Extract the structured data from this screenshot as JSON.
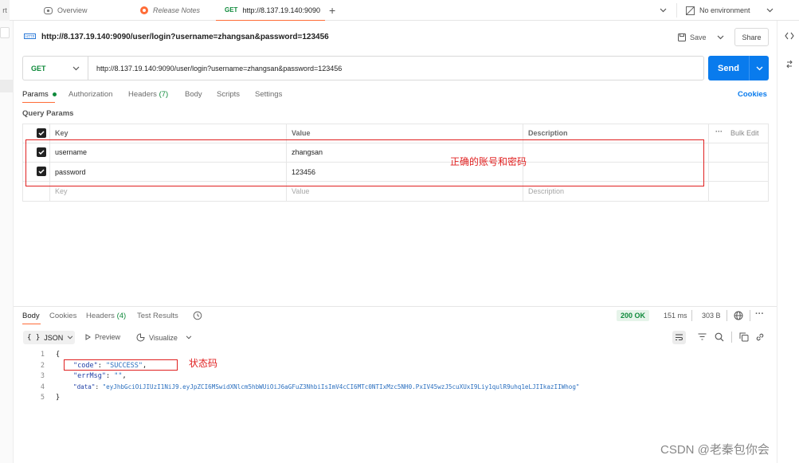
{
  "tabs": {
    "partial_left": "rt",
    "overview": "Overview",
    "release_notes": "Release Notes",
    "active_method": "GET",
    "active_url": "http://8.137.19.140:9090",
    "new_tab": "+",
    "environment": "No environment"
  },
  "request": {
    "title_url": "http://8.137.19.140:9090/user/login?username=zhangsan&password=123456",
    "save_label": "Save",
    "share_label": "Share",
    "method": "GET",
    "url": "http://8.137.19.140:9090/user/login?username=zhangsan&password=123456",
    "send_label": "Send"
  },
  "request_tabs": [
    {
      "label": "Params"
    },
    {
      "label": "Authorization"
    },
    {
      "label": "Headers",
      "count": "(7)"
    },
    {
      "label": "Body"
    },
    {
      "label": "Scripts"
    },
    {
      "label": "Settings"
    }
  ],
  "cookies_link": "Cookies",
  "query_params": {
    "section_title": "Query Params",
    "headers": {
      "key": "Key",
      "value": "Value",
      "description": "Description",
      "bulk_edit": "Bulk Edit"
    },
    "rows": [
      {
        "key": "username",
        "value": "zhangsan",
        "checked": true
      },
      {
        "key": "password",
        "value": "123456",
        "checked": true
      }
    ],
    "placeholder": {
      "key": "Key",
      "value": "Value",
      "description": "Description"
    },
    "annotation": "正确的账号和密码"
  },
  "response": {
    "tabs": [
      {
        "label": "Body"
      },
      {
        "label": "Cookies"
      },
      {
        "label": "Headers",
        "count": "(4)"
      },
      {
        "label": "Test Results"
      }
    ],
    "status": "200 OK",
    "time": "151 ms",
    "size": "303 B",
    "format": "JSON",
    "preview_label": "Preview",
    "visualize_label": "Visualize",
    "lines": [
      "1",
      "2",
      "3",
      "4",
      "5"
    ],
    "code_open": "{",
    "code_key": "\"code\"",
    "code_val": "\"SUCCESS\"",
    "errmsg_key": "\"errMsg\"",
    "errmsg_val": "\"\"",
    "data_key": "\"data\"",
    "data_val": "\"eyJhbGciOiJIUzI1NiJ9.eyJpZCI6MSwidXNlcm5hbWUiOiJ6aGFuZ3NhbiIsImV4cCI6MTc0NTIxMzc5NH0.PxIV45wzJ5cuXUxI9Liy1qulR9uhq1eLJIIkazIIWhog\"",
    "code_close": "}",
    "annotation": "状态码"
  },
  "watermark": "CSDN @老秦包你会"
}
